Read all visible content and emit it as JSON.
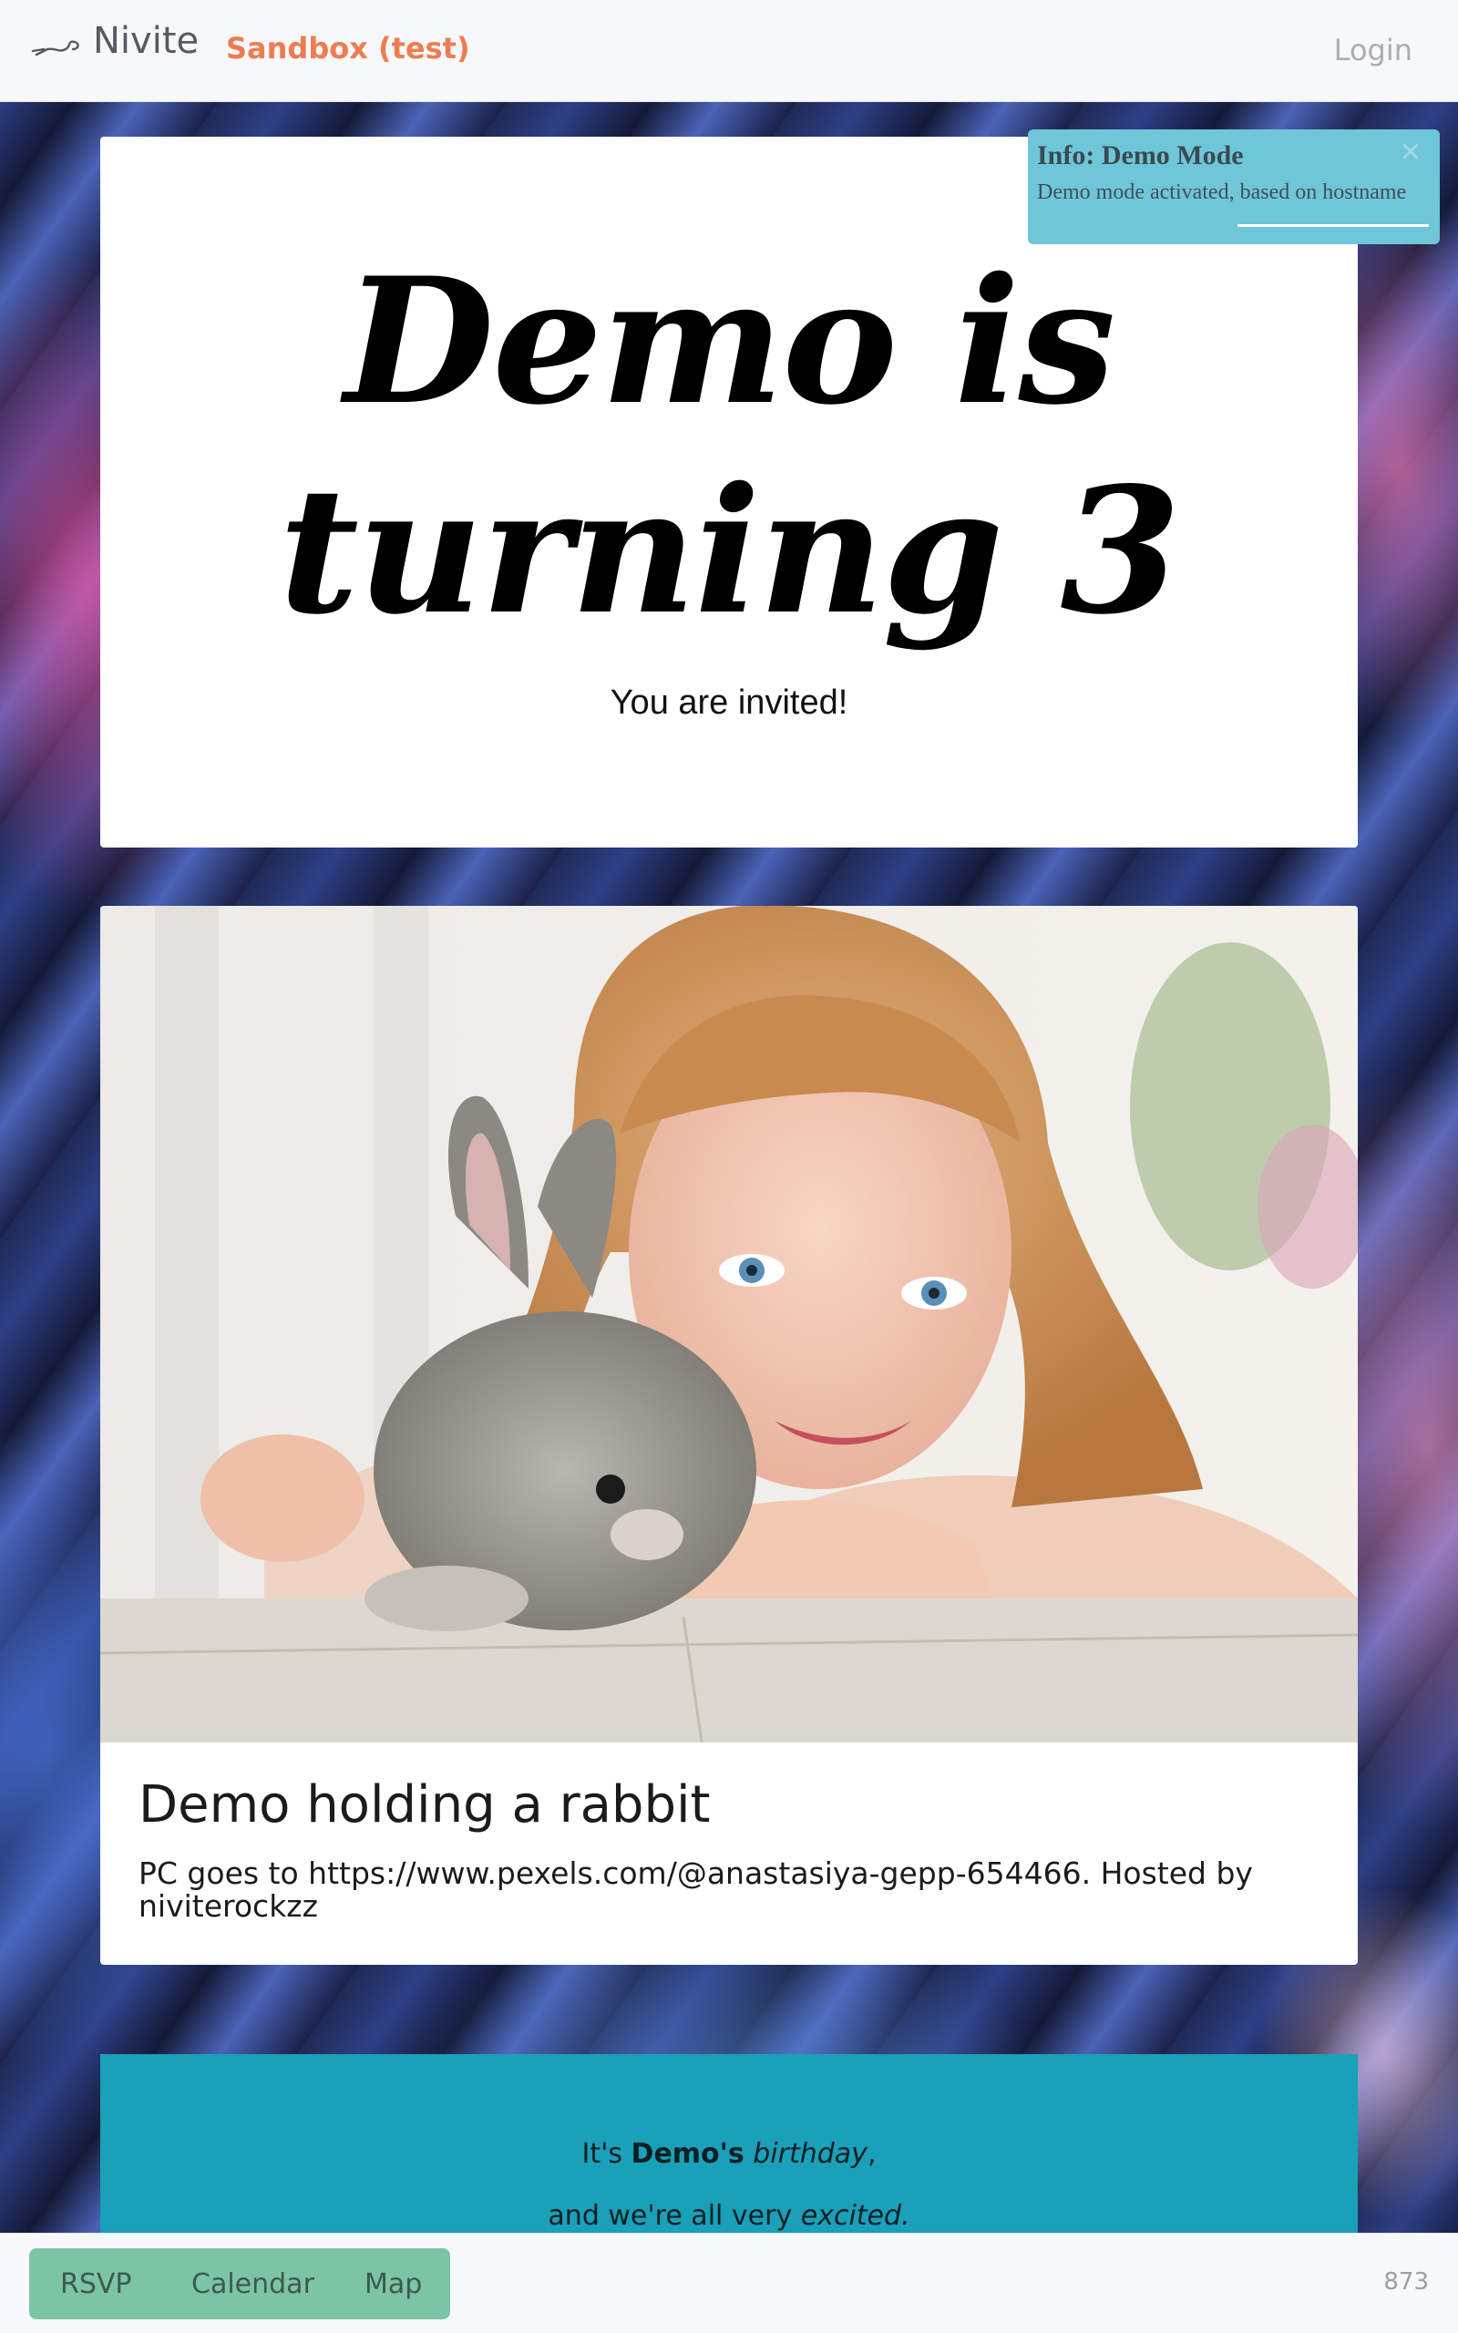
{
  "header": {
    "brand": "Nivite",
    "environment": "Sandbox (test)",
    "login": "Login"
  },
  "toast": {
    "title": "Info: Demo Mode",
    "message": "Demo mode activated, based on hostname"
  },
  "title_card": {
    "heading_line1": "Demo is",
    "heading_line2": "turning 3",
    "subtitle": "You are invited!"
  },
  "photo_card": {
    "title": "Demo holding a rabbit",
    "caption": "PC goes to https://www.pexels.com/@anastasiya-gepp-654466. Hosted by niviterockzz"
  },
  "message": {
    "line1_prefix": "It's ",
    "line1_name": "Demo's",
    "line1_word": " birthday",
    "line1_suffix": ",",
    "line2_prefix": "and we're all very ",
    "line2_word": "excited."
  },
  "bottom_nav": {
    "rsvp": "RSVP",
    "calendar": "Calendar",
    "map": "Map",
    "counter": "873"
  },
  "icons": {
    "brand": "brand-logo-icon",
    "close": "close-icon"
  },
  "colors": {
    "environment": "#ee7c52",
    "toast_bg": "#6ec6d8",
    "message_bg": "#1aa0b8",
    "bottom_nav_bg": "#7cc4a6"
  }
}
